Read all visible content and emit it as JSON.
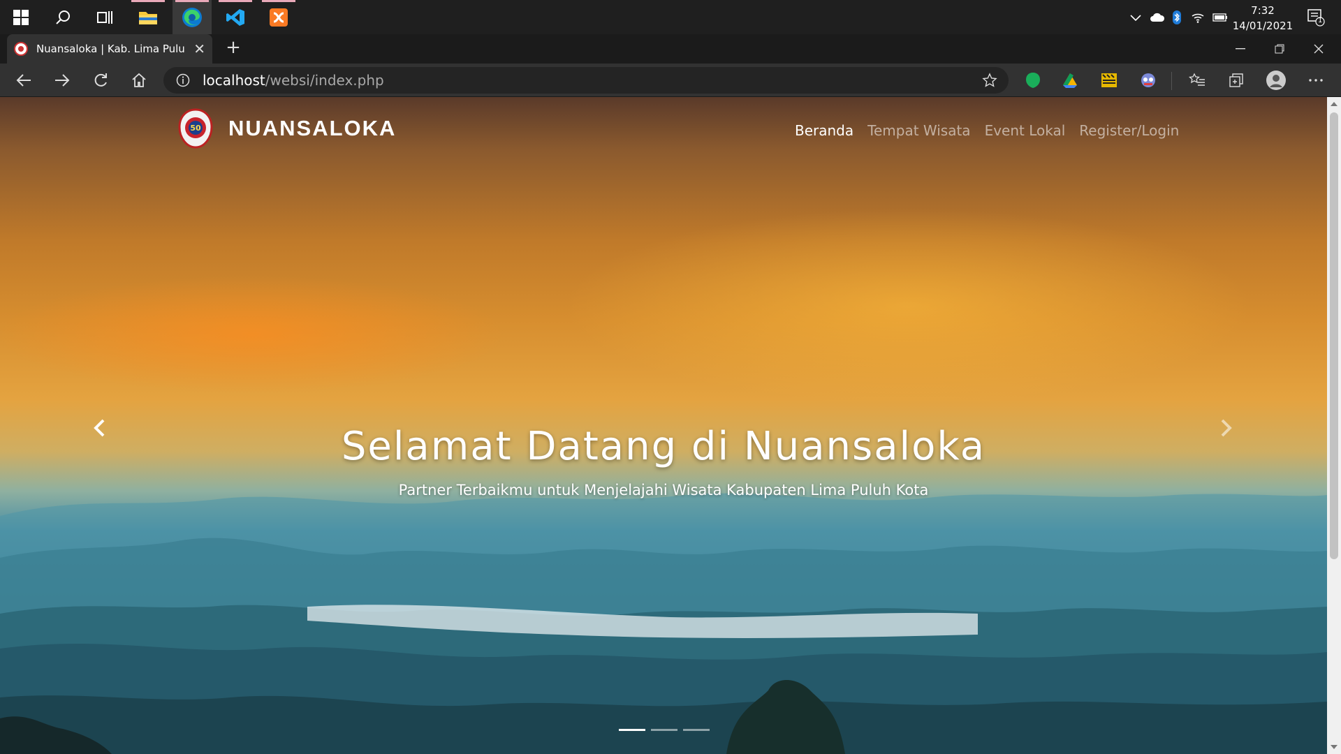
{
  "taskbar": {
    "apps": [
      "windows-start",
      "search",
      "task-view",
      "file-explorer",
      "edge",
      "vscode",
      "xampp"
    ],
    "clock": {
      "time": "7:32",
      "date": "14/01/2021"
    },
    "notification_count": "1"
  },
  "browser": {
    "tab_title": "Nuansaloka | Kab. Lima Puluh Ko",
    "url_host": "localhost",
    "url_path": "/websi/index.php"
  },
  "site": {
    "brand": "NUANSALOKA",
    "logo_text": "50",
    "nav": [
      {
        "label": "Beranda",
        "active": true
      },
      {
        "label": "Tempat Wisata",
        "active": false
      },
      {
        "label": "Event Lokal",
        "active": false
      },
      {
        "label": "Register/Login",
        "active": false
      }
    ],
    "hero": {
      "title": "Selamat Datang di Nuansaloka",
      "subtitle": "Partner Terbaikmu untuk Menjelajahi Wisata Kabupaten Lima Puluh Kota"
    },
    "carousel": {
      "slides": 3,
      "active_index": 0
    }
  },
  "colors": {
    "taskbar": "#1f1f1f",
    "toolbar": "#323232",
    "edge_accent": "#1fa2e0",
    "vscode_blue": "#23a9f2",
    "xampp_orange": "#fb7a24"
  }
}
